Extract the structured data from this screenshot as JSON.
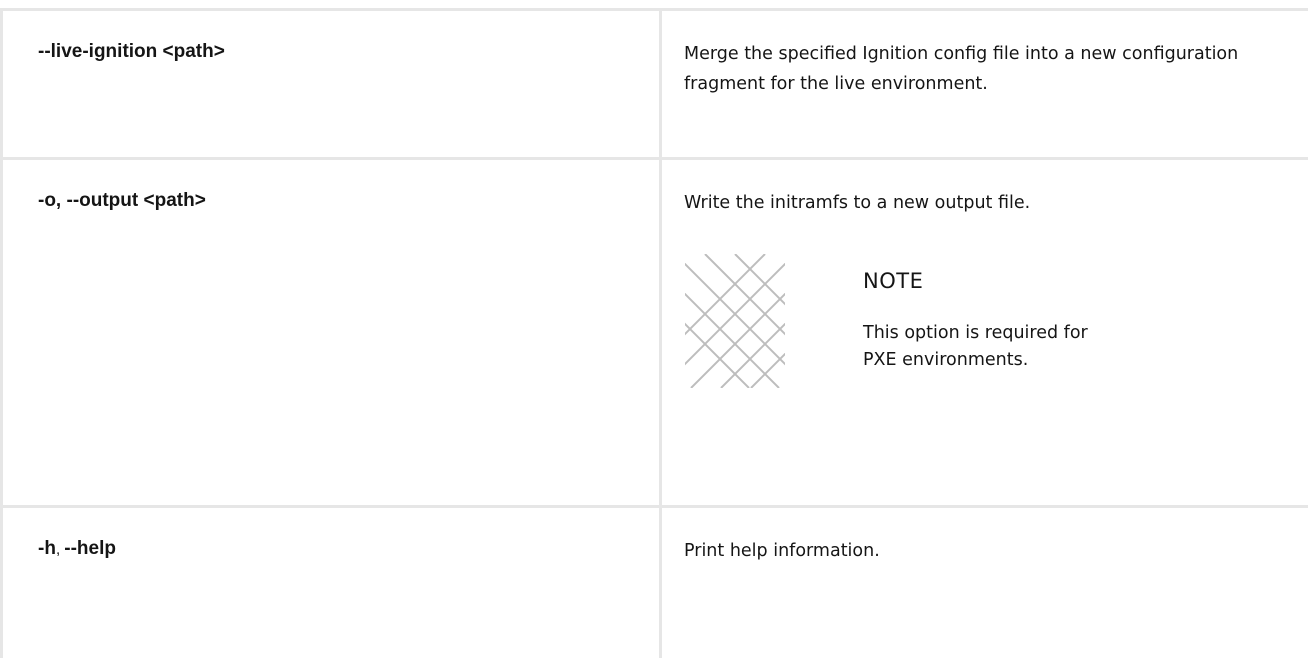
{
  "options": [
    {
      "option": "--live-ignition <path>",
      "description": "Merge the specified Ignition config file into a new configuration fragment for the live environment."
    },
    {
      "option": "-o, --output <path>",
      "description": "Write the initramfs to a new output file.",
      "note": {
        "icon": "note-pattern-icon",
        "title": "NOTE",
        "text": "This option is required for PXE environments."
      }
    },
    {
      "option_part1": "-h",
      "option_sep": ", ",
      "option_part2": "--help",
      "description": "Print help information."
    }
  ]
}
